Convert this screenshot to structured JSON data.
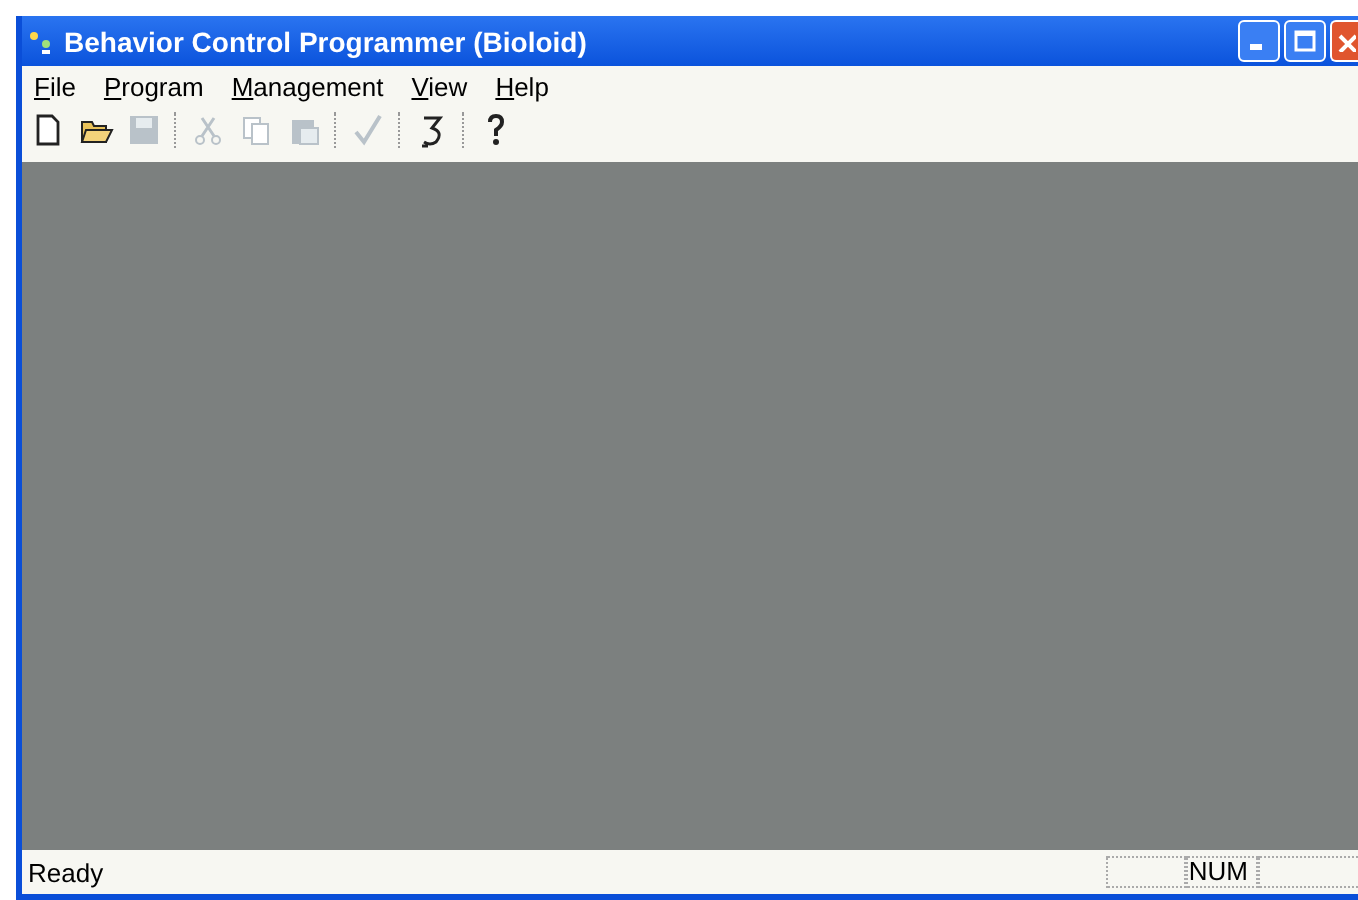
{
  "window": {
    "title": "Behavior Control Programmer (Bioloid)"
  },
  "menu": [
    {
      "label": "File"
    },
    {
      "label": "Program"
    },
    {
      "label": "Management"
    },
    {
      "label": "View"
    },
    {
      "label": "Help"
    }
  ],
  "toolbar": [
    {
      "kind": "new",
      "disabled": false
    },
    {
      "kind": "open",
      "disabled": false
    },
    {
      "kind": "save",
      "disabled": true
    },
    {
      "kind": "separator"
    },
    {
      "kind": "cut",
      "disabled": true
    },
    {
      "kind": "copy",
      "disabled": true
    },
    {
      "kind": "paste",
      "disabled": true
    },
    {
      "kind": "separator"
    },
    {
      "kind": "check",
      "disabled": true
    },
    {
      "kind": "separator"
    },
    {
      "kind": "download",
      "disabled": false
    },
    {
      "kind": "separator"
    },
    {
      "kind": "help",
      "disabled": false
    }
  ],
  "status_bar": {
    "message": "Ready",
    "indicator": "NUM"
  }
}
